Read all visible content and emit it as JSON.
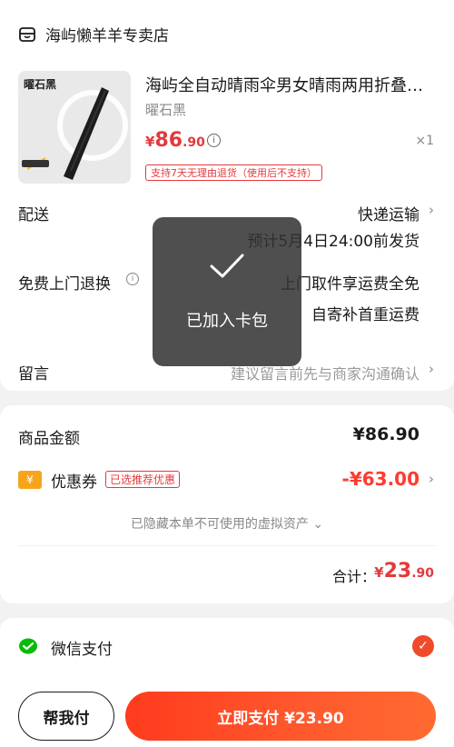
{
  "store": {
    "name": "海屿懒羊羊专卖店",
    "icon": "store-icon"
  },
  "product": {
    "image_brand": "曜石黑",
    "title": "海屿全自动晴雨伞男女晴雨两用折叠…",
    "sku": "曜石黑",
    "price_currency": "¥",
    "price_int": "86",
    "price_dec": ".90",
    "quantity": "×1",
    "return_tag": "支持7天无理由退货（使用后不支持）"
  },
  "delivery": {
    "label": "配送",
    "method": "快递运输",
    "eta": "预计5月4日24:00前发货"
  },
  "free_return": {
    "label": "免费上门退换",
    "line1": "上门取件享运费全免",
    "line2": "自寄补首重运费"
  },
  "message": {
    "label": "留言",
    "placeholder": "建议留言前先与商家沟通确认"
  },
  "price_summary": {
    "goods_label": "商品金额",
    "goods_amount": "¥86.90",
    "coupon_icon_text": "¥",
    "coupon_label": "优惠券",
    "coupon_tag": "已选推荐优惠",
    "coupon_amount": "-¥63.00",
    "hidden_assets": "已隐藏本单不可使用的虚拟资产",
    "total_label": "合计：",
    "total_currency": "¥",
    "total_int": "23",
    "total_dec": ".90"
  },
  "payment": {
    "method_label": "微信支付",
    "selected": true
  },
  "bottom_bar": {
    "help_pay_label": "帮我付",
    "pay_now_label": "立即支付 ¥23.90"
  },
  "toast": {
    "text": "已加入卡包"
  },
  "colors": {
    "price_red": "#e4393c",
    "pay_button": "#ff3b1d",
    "wechat_green": "#09bb07",
    "coupon_orange": "#f7a41d"
  }
}
